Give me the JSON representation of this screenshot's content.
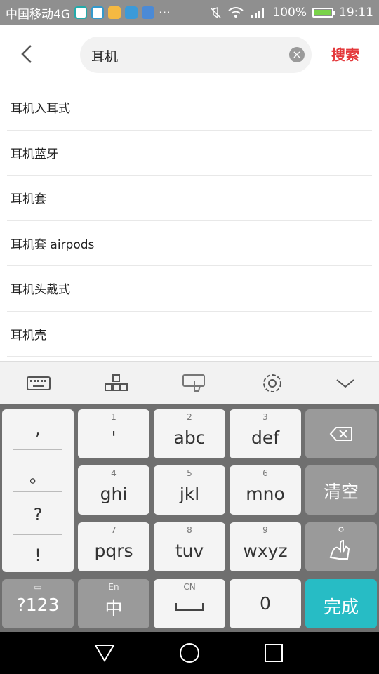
{
  "status_bar": {
    "carrier": "中国移动4G",
    "battery": "100%",
    "time": "19:11",
    "battery_level": 1.0,
    "icons": [
      "app-icon-1",
      "app-icon-2",
      "app-icon-3",
      "app-icon-4",
      "app-icon-5",
      "mute-icon",
      "wifi-icon",
      "signal-icon",
      "battery-icon"
    ]
  },
  "search": {
    "query": "耳机",
    "search_button": "搜索",
    "accent": "#e4393c"
  },
  "suggestions": [
    "耳机入耳式",
    "耳机蓝牙",
    "耳机套",
    "耳机套 airpods",
    "耳机头戴式",
    "耳机壳"
  ],
  "keyboard": {
    "punct": [
      ",",
      "。",
      "?",
      "!"
    ],
    "keys": [
      {
        "num": "1",
        "main": "'"
      },
      {
        "num": "2",
        "main": "abc"
      },
      {
        "num": "3",
        "main": "def"
      },
      {
        "num": "4",
        "main": "ghi"
      },
      {
        "num": "5",
        "main": "jkl"
      },
      {
        "num": "6",
        "main": "mno"
      },
      {
        "num": "7",
        "main": "pqrs"
      },
      {
        "num": "8",
        "main": "tuv"
      },
      {
        "num": "9",
        "main": "wxyz"
      }
    ],
    "clear": "清空",
    "symbols": "?123",
    "lang_hint": "En",
    "lang": "中",
    "space_hint": "CN",
    "zero": "0",
    "done": "完成",
    "done_color": "#27bcc5"
  }
}
